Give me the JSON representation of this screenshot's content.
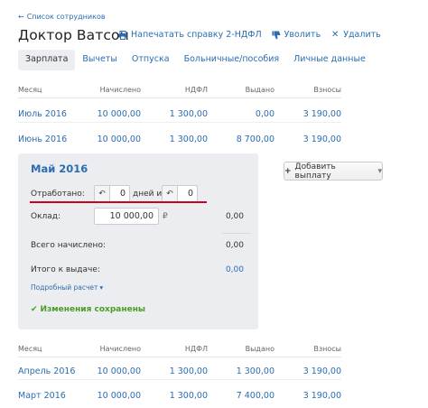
{
  "back_link": {
    "arrow": "←",
    "label": "Список сотрудников"
  },
  "employee_name": "Доктор Ватсон",
  "actions": [
    {
      "icon": "print-icon",
      "label": "Напечатать справку 2-НДФЛ"
    },
    {
      "icon": "thumb-down-icon",
      "label": "Уволить"
    },
    {
      "icon": "close-icon",
      "label": "Удалить"
    }
  ],
  "tabs": [
    "Зарплата",
    "Вычеты",
    "Отпуска",
    "Больничные/пособия",
    "Личные данные"
  ],
  "table_headers": [
    "Месяц",
    "Начислено",
    "НДФЛ",
    "Выдано",
    "Взносы"
  ],
  "rows_top": [
    [
      "Июль 2016",
      "10 000,00",
      "1 300,00",
      "0,00",
      "3 190,00"
    ],
    [
      "Июнь 2016",
      "10 000,00",
      "1 300,00",
      "8 700,00",
      "3 190,00"
    ]
  ],
  "panel": {
    "title": "Май 2016",
    "worked_label": "Отработано:",
    "worked_days": "0",
    "days_of_label": "дней из",
    "days_total": "0",
    "salary_label": "Оклад:",
    "salary_value": "10 000,00",
    "currency": "₽",
    "salary_result": "0,00",
    "total_accrued_label": "Всего начислено:",
    "total_accrued_value": "0,00",
    "to_pay_label": "Итого к выдаче:",
    "to_pay_value": "0,00",
    "details_label": "Подробный расчет",
    "saved_label": "Изменения сохранены"
  },
  "add_payment_label": "Добавить выплату",
  "rows_bottom": [
    [
      "Апрель 2016",
      "10 000,00",
      "1 300,00",
      "1 300,00",
      "3 190,00"
    ],
    [
      "Март 2016",
      "10 000,00",
      "1 300,00",
      "7 400,00",
      "3 190,00"
    ]
  ],
  "colors": {
    "link": "#2a6db0",
    "accent_red": "#d0021b",
    "success": "#4b9c27",
    "panel_bg": "#ebedf0"
  }
}
